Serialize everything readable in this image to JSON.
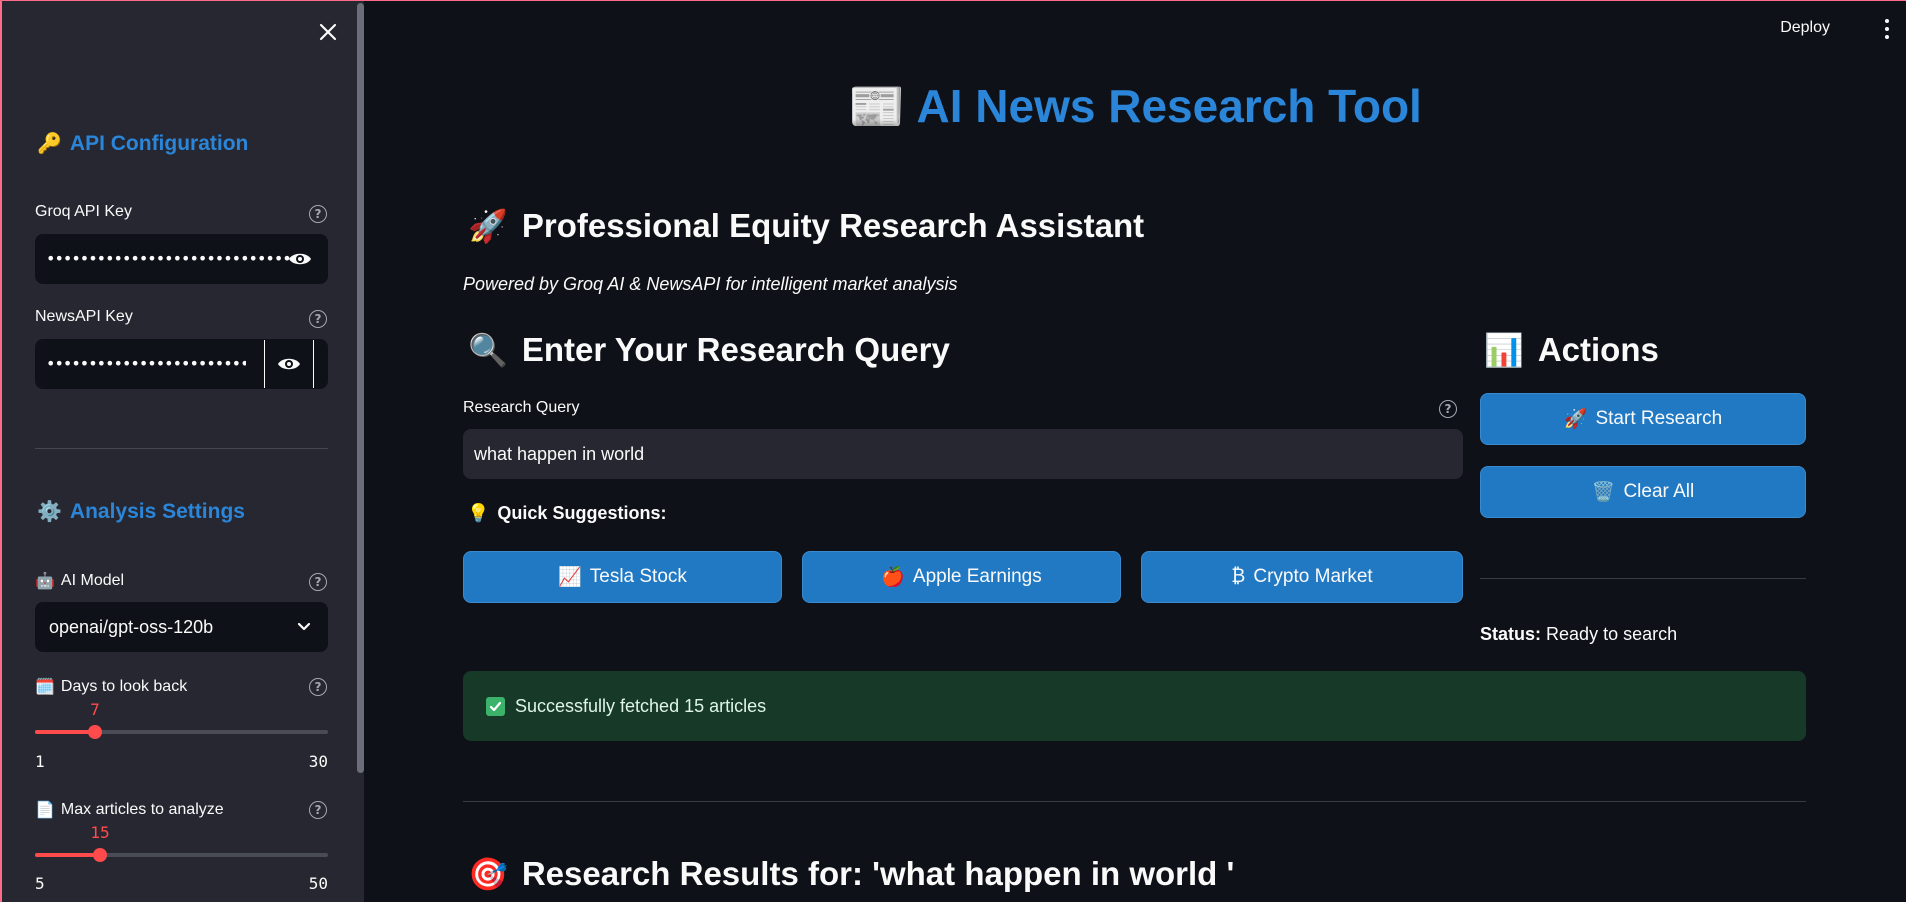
{
  "sidebar": {
    "api_section": {
      "emoji": "🔑",
      "title": "API Configuration"
    },
    "groq_key": {
      "label": "Groq API Key",
      "value": "••••••••••••••••••••••••••••••••••••••"
    },
    "news_key": {
      "label": "NewsAPI Key",
      "value": "•••••••••••••••••••••••••••••••••••"
    },
    "analysis_section": {
      "emoji": "⚙️",
      "title": "Analysis Settings"
    },
    "model": {
      "emoji": "🤖",
      "label": "AI Model",
      "value": "openai/gpt-oss-120b"
    },
    "days_slider": {
      "emoji": "🗓️",
      "label": "Days to look back",
      "value": "7",
      "min": "1",
      "max": "30"
    },
    "articles_slider": {
      "emoji": "📄",
      "label": "Max articles to analyze",
      "value": "15",
      "min": "5",
      "max": "50"
    }
  },
  "header": {
    "deploy_label": "Deploy"
  },
  "main": {
    "title": "📰 AI News Research Tool",
    "assistant_heading": {
      "emoji": "🚀",
      "text": "Professional Equity Research Assistant"
    },
    "subtitle": "Powered by Groq AI & NewsAPI for intelligent market analysis",
    "query_heading": {
      "emoji": "🔍",
      "text": "Enter Your Research Query"
    },
    "query_label": "Research Query",
    "query_value": "what happen in world",
    "quick": {
      "emoji": "💡",
      "label": "Quick Suggestions:"
    },
    "suggestions": [
      {
        "emoji": "📈",
        "label": "Tesla Stock"
      },
      {
        "emoji": "🍎",
        "label": "Apple Earnings"
      },
      {
        "emoji": "₿",
        "label": "Crypto Market"
      }
    ],
    "actions_heading": {
      "emoji": "📊",
      "text": "Actions"
    },
    "start_button": {
      "emoji": "🚀",
      "label": "Start Research"
    },
    "clear_button": {
      "emoji": "🗑️",
      "label": "Clear All"
    },
    "status": {
      "label": "Status:",
      "value": "Ready to search"
    },
    "success_message": "Successfully fetched 15 articles",
    "results_heading": {
      "emoji": "🎯",
      "text": "Research Results for: 'what happen in world '"
    }
  },
  "colors": {
    "accent": "#2b86d9",
    "button": "#2179c4",
    "slider": "#ff4b4b",
    "success_bg": "#173928"
  }
}
